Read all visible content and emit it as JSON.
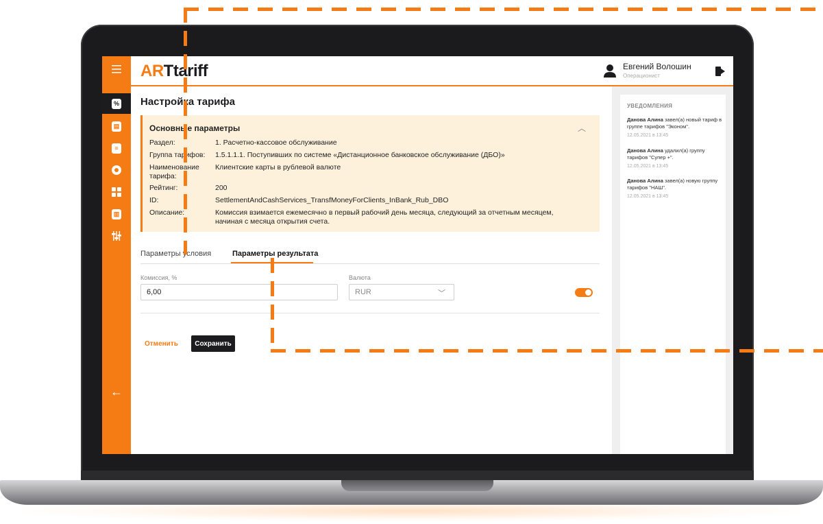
{
  "app": {
    "logo_prefix": "AR",
    "logo_suffix": "Ttariff"
  },
  "user": {
    "name": "Евгений Волошин",
    "role": "Операционист"
  },
  "page": {
    "title": "Настройка тарифа"
  },
  "params": {
    "title": "Основные параметры",
    "rows": [
      {
        "key": "Раздел:",
        "value": "1. Расчетно-кассовое обслуживание"
      },
      {
        "key": "Группа тарифов:",
        "value": "1.5.1.1.1. Поступивших по системе «Дистанционное банковское обслуживание (ДБО)»"
      },
      {
        "key": "Наименование тарифа:",
        "value": "Клиентские карты в рублевой валюте"
      },
      {
        "key": "Рейтинг:",
        "value": "200"
      },
      {
        "key": "ID:",
        "value": "SettlementAndCashServices_TransfMoneyForClients_InBank_Rub_DBO"
      },
      {
        "key": "Описание:",
        "value": "Комиссия взимается ежемесячно в первый рабочий день месяца, следующий за отчетным месяцем, начиная с месяца открытия счета."
      }
    ]
  },
  "tabs": [
    {
      "label": "Параметры условия",
      "active": false
    },
    {
      "label": "Параметры результата",
      "active": true
    }
  ],
  "form": {
    "commission_label": "Комиссия, %",
    "commission_value": "6,00",
    "currency_label": "Валюта",
    "currency_value": "RUR",
    "toggle_on": true
  },
  "actions": {
    "cancel": "Отменить",
    "save": "Сохранить"
  },
  "notifications": {
    "title": "УВЕДОМЛЕНИЯ",
    "items": [
      {
        "author": "Данова Алина",
        "text": " завел(а) новый тариф в группе тарифов \"Эконом\".",
        "time": "12.05.2021 в 13:45"
      },
      {
        "author": "Данова Алина",
        "text": " удалил(а) группу тарифов \"Супер +\".",
        "time": "12.05.2021 в 13:45"
      },
      {
        "author": "Данова Алина",
        "text": " завел(а) новую группу тарифов \"НАШ\".",
        "time": "12.05.2021 в 13:45"
      }
    ]
  },
  "icons": [
    "menu-icon",
    "tariff-icon",
    "clipboard-icon",
    "list-icon",
    "settings-icon",
    "grid-icon",
    "document-icon",
    "filters-icon",
    "back-arrow-icon",
    "user-icon",
    "logout-icon",
    "chevron-up-icon",
    "chevron-down-icon"
  ],
  "colors": {
    "accent": "#f57c14",
    "dark": "#1c1c1e",
    "params_bg": "#fdf1dc"
  }
}
